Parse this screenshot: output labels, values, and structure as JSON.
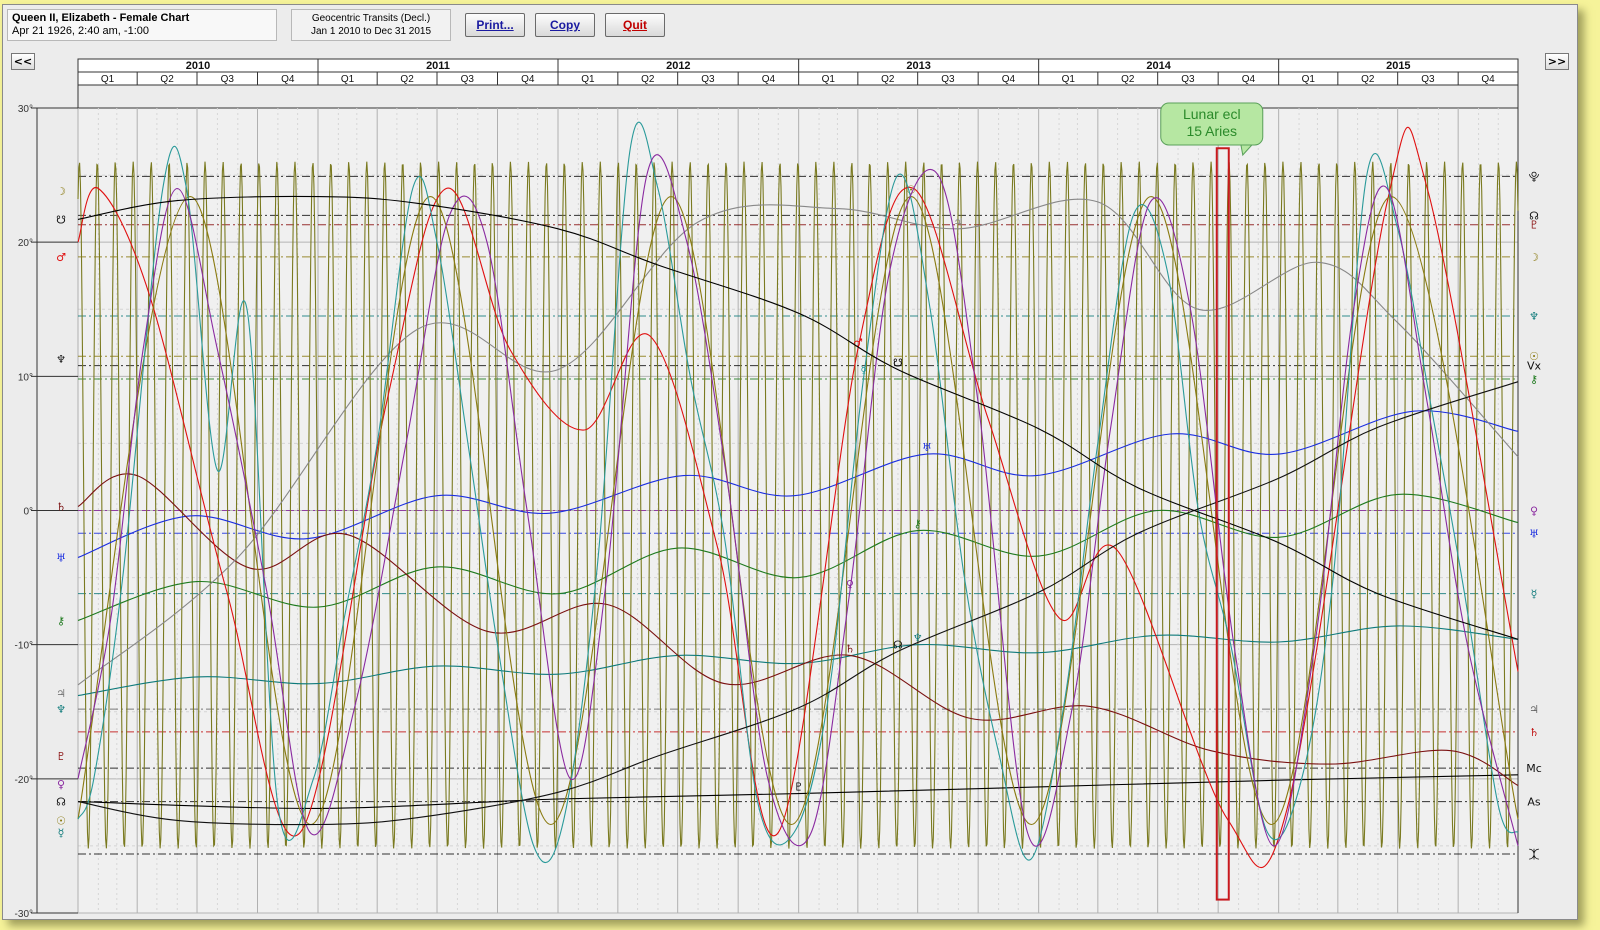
{
  "header": {
    "chart_name": "Queen II, Elizabeth - Female Chart",
    "birth_data": "Apr 21 1926, 2:40 am, -1:00",
    "chart_type": "Geocentric Transits (Decl.)",
    "date_range": "Jan 1 2010 to Dec 31 2015"
  },
  "buttons": {
    "print": "Print...",
    "copy": "Copy",
    "quit": "Quit"
  },
  "nav": {
    "prev": "<<",
    "next": ">>"
  },
  "colors": {
    "frame_bg": "#ececec",
    "plot_bg": "#f0f0f0",
    "outer_bg": "#f6f39a",
    "print_text": "#1a1aa0",
    "copy_text": "#1a1aa0",
    "quit_text": "#c00000",
    "event_box": "#c8191e",
    "tooltip_bg": "#b6e7a2"
  },
  "chart_data": {
    "type": "line",
    "x": {
      "start": "2010-01-01",
      "end": "2015-12-31",
      "years": [
        "2010",
        "2011",
        "2012",
        "2013",
        "2014",
        "2015"
      ],
      "quarters": [
        "Q1",
        "Q2",
        "Q3",
        "Q4"
      ]
    },
    "ylim": [
      -30,
      30
    ],
    "yticks": [
      30,
      20,
      10,
      0,
      -10,
      -20,
      -30
    ],
    "ytick_labels": [
      "30°",
      "20°",
      "10°",
      "0°",
      "-10°",
      "-20°",
      "-30°"
    ],
    "grid": true,
    "event": {
      "label_line1": "Lunar ecl",
      "label_line2": "15 Aries",
      "date": "2014-10-08"
    },
    "moon": {
      "color": "#7a7a20",
      "amplitude": 25.6,
      "period_days": 27.32,
      "mean": 0.4
    },
    "series": [
      {
        "glyph": "♇",
        "color": "#000000",
        "x": [
          "2010-01-01",
          "2011-01-01",
          "2012-01-01",
          "2013-01-01",
          "2014-01-01",
          "2015-01-01",
          "2015-12-31"
        ],
        "y": [
          -21.7,
          -22.2,
          -21.5,
          -21.1,
          -20.6,
          -20.1,
          -19.7
        ]
      },
      {
        "glyph": "♆",
        "color": "#0e7a7a",
        "x": [
          "2010-01-01",
          "2010-07-01",
          "2011-01-01",
          "2011-07-01",
          "2012-01-01",
          "2012-07-01",
          "2013-01-01",
          "2013-07-01",
          "2014-01-01",
          "2014-07-01",
          "2015-01-01",
          "2015-07-01",
          "2015-12-31"
        ],
        "y": [
          -13.8,
          -12.4,
          -12.9,
          -11.6,
          -12.2,
          -10.8,
          -11.4,
          -10.0,
          -10.6,
          -9.3,
          -9.8,
          -8.6,
          -9.6
        ]
      },
      {
        "glyph": "♅",
        "color": "#1a2ee0",
        "x": [
          "2010-01-01",
          "2010-06-20",
          "2010-12-15",
          "2011-07-01",
          "2011-12-20",
          "2012-07-10",
          "2012-12-25",
          "2013-07-15",
          "2013-12-28",
          "2014-07-20",
          "2015-01-01",
          "2015-07-25",
          "2015-12-31"
        ],
        "y": [
          -3.5,
          -0.4,
          -2.1,
          1.1,
          -0.2,
          2.6,
          1.1,
          4.2,
          2.6,
          5.7,
          4.2,
          7.4,
          5.9
        ]
      },
      {
        "glyph": "⚷",
        "color": "#1e7a1e",
        "x": [
          "2010-01-01",
          "2010-07-01",
          "2011-01-01",
          "2011-07-01",
          "2012-01-01",
          "2012-07-01",
          "2013-01-01",
          "2013-07-01",
          "2014-01-01",
          "2014-07-01",
          "2015-01-01",
          "2015-07-01",
          "2015-12-31"
        ],
        "y": [
          -8.2,
          -5.3,
          -7.2,
          -4.2,
          -6.2,
          -2.8,
          -5.0,
          -1.5,
          -3.4,
          0.0,
          -2.0,
          1.2,
          -0.9
        ]
      },
      {
        "glyph": "♄",
        "color": "#7a1010",
        "x": [
          "2010-01-01",
          "2010-04-01",
          "2010-09-20",
          "2011-02-15",
          "2011-09-15",
          "2012-03-15",
          "2012-09-10",
          "2013-03-20",
          "2013-09-20",
          "2014-03-20",
          "2014-09-20",
          "2015-03-20",
          "2015-09-20",
          "2015-12-31"
        ],
        "y": [
          0.3,
          2.6,
          -4.3,
          -1.8,
          -9.0,
          -7.0,
          -12.9,
          -10.8,
          -15.5,
          -14.6,
          -17.9,
          -18.9,
          -17.9,
          -20.5
        ]
      },
      {
        "glyph": "♃",
        "color": "#888888",
        "x": [
          "2010-01-01",
          "2010-09-01",
          "2011-06-01",
          "2012-01-01",
          "2012-08-01",
          "2013-03-01",
          "2013-09-01",
          "2014-04-01",
          "2014-09-01",
          "2015-03-01",
          "2015-07-01",
          "2015-12-31"
        ],
        "y": [
          -13.0,
          -3.5,
          13.5,
          10.5,
          21.5,
          22.5,
          21.0,
          23.0,
          15.0,
          18.5,
          14.0,
          4.0
        ]
      },
      {
        "glyph": "♂",
        "color": "#e01010",
        "x": [
          "2010-01-01",
          "2010-02-01",
          "2010-04-20",
          "2010-08-15",
          "2010-12-05",
          "2011-04-15",
          "2011-07-15",
          "2011-10-20",
          "2012-02-10",
          "2012-05-20",
          "2012-09-01",
          "2012-12-01",
          "2013-04-01",
          "2013-06-25",
          "2013-10-15",
          "2014-02-01",
          "2014-05-01",
          "2014-10-15",
          "2015-01-15",
          "2015-06-15",
          "2015-08-15",
          "2015-12-31"
        ],
        "y": [
          20,
          24,
          16,
          -6,
          -24,
          8,
          24,
          12,
          6,
          13,
          -3,
          -24,
          12,
          24,
          7,
          -8,
          -3,
          -23,
          -22,
          23,
          24,
          -12
        ]
      },
      {
        "glyph": "☉",
        "color": "#8a7a10",
        "x": [
          "2010-01-01",
          "2010-06-21",
          "2010-12-21",
          "2011-06-21",
          "2011-12-21",
          "2012-06-21",
          "2012-12-21",
          "2013-06-21",
          "2013-12-21",
          "2014-06-21",
          "2014-12-21",
          "2015-06-21",
          "2015-12-31"
        ],
        "y": [
          -23,
          23.4,
          -23.4,
          23.4,
          -23.4,
          23.4,
          -23.4,
          23.4,
          -23.4,
          23.4,
          -23.4,
          23.4,
          -23
        ]
      },
      {
        "glyph": "☿",
        "color": "#2a9a9a",
        "x": [
          "2010-01-01",
          "2010-01-25",
          "2010-03-10",
          "2010-05-10",
          "2010-06-15",
          "2010-08-01",
          "2010-09-15",
          "2010-11-01",
          "2010-12-25",
          "2011-02-10",
          "2011-04-01",
          "2011-05-25",
          "2011-07-01",
          "2011-08-20",
          "2011-10-01",
          "2011-11-25",
          "2012-01-10",
          "2012-03-01",
          "2012-04-20",
          "2012-06-01",
          "2012-07-20",
          "2012-09-10",
          "2012-11-01",
          "2012-12-25",
          "2013-02-15",
          "2013-04-10",
          "2013-06-01",
          "2013-07-20",
          "2013-09-10",
          "2013-11-01",
          "2013-12-20",
          "2014-02-10",
          "2014-04-01",
          "2014-05-25",
          "2014-07-15",
          "2014-09-01",
          "2014-10-20",
          "2014-12-15",
          "2015-02-05",
          "2015-03-25",
          "2015-05-15",
          "2015-07-01",
          "2015-08-20",
          "2015-10-10",
          "2015-12-01",
          "2015-12-31"
        ],
        "y": [
          -23,
          -20,
          -5,
          24,
          24,
          3,
          15,
          -22,
          -20,
          -8,
          5,
          24,
          20,
          4,
          -10,
          -25,
          -23,
          -4,
          27,
          24,
          10,
          -2,
          -22,
          -24,
          -14,
          10,
          25,
          15,
          -5,
          -18,
          -26,
          -14,
          5,
          22,
          18,
          0,
          -10,
          -24,
          -20,
          -5,
          25,
          21,
          8,
          -6,
          -22,
          -24
        ]
      },
      {
        "glyph": "♀",
        "color": "#8a2aa0",
        "x": [
          "2010-01-01",
          "2010-02-20",
          "2010-04-10",
          "2010-06-01",
          "2010-08-01",
          "2010-10-15",
          "2010-12-20",
          "2011-03-01",
          "2011-05-15",
          "2011-07-20",
          "2011-09-15",
          "2011-11-15",
          "2012-01-20",
          "2012-03-15",
          "2012-05-15",
          "2012-07-15",
          "2012-09-15",
          "2012-11-15",
          "2013-01-20",
          "2013-03-20",
          "2013-05-20",
          "2013-08-01",
          "2013-10-01",
          "2013-12-15",
          "2014-02-20",
          "2014-04-20",
          "2014-06-20",
          "2014-08-20",
          "2014-10-25",
          "2014-12-25",
          "2015-02-25",
          "2015-04-25",
          "2015-06-15",
          "2015-08-15",
          "2015-10-15",
          "2015-12-31"
        ],
        "y": [
          -20,
          -8,
          12,
          24,
          12,
          -6,
          -24,
          -14,
          5,
          22,
          20,
          0,
          -20,
          -5,
          25,
          20,
          2,
          -20,
          -24,
          -6,
          18,
          25,
          8,
          -24,
          -15,
          6,
          23,
          15,
          -10,
          -25,
          -10,
          15,
          24,
          8,
          -10,
          -25
        ]
      },
      {
        "glyph": "☊",
        "color": "#111111",
        "x": [
          "2010-01-01",
          "2010-06-01",
          "2011-01-01",
          "2011-06-01",
          "2012-01-01",
          "2012-06-01",
          "2013-01-01",
          "2013-06-01",
          "2014-01-01",
          "2014-06-01",
          "2015-01-01",
          "2015-06-01",
          "2015-12-31"
        ],
        "y": [
          -21.7,
          -23.1,
          -23.4,
          -22.9,
          -21.0,
          -18.3,
          -14.7,
          -10.5,
          -6.1,
          -1.7,
          2.4,
          6.2,
          9.6
        ]
      },
      {
        "glyph": "☋",
        "color": "#000000",
        "x": [
          "2010-01-01",
          "2010-06-01",
          "2011-01-01",
          "2011-06-01",
          "2012-01-01",
          "2012-06-01",
          "2013-01-01",
          "2013-06-01",
          "2014-01-01",
          "2014-06-01",
          "2015-01-01",
          "2015-06-01",
          "2015-12-31"
        ],
        "y": [
          21.7,
          23.1,
          23.4,
          22.9,
          21.0,
          18.3,
          14.7,
          10.5,
          6.1,
          1.7,
          -2.4,
          -6.2,
          -9.6
        ]
      }
    ],
    "natal_lines": [
      {
        "glyph": "⯓",
        "value": 24.9,
        "color": "#111111"
      },
      {
        "glyph": "☊",
        "value": 22.0,
        "color": "#111111"
      },
      {
        "glyph": "♇",
        "value": 21.3,
        "color": "#8a1010"
      },
      {
        "glyph": "☽",
        "value": 18.9,
        "color": "#8a7a10"
      },
      {
        "glyph": "♆",
        "value": 14.5,
        "color": "#0e7a7a"
      },
      {
        "glyph": "☉",
        "value": 11.5,
        "color": "#8a7a10"
      },
      {
        "glyph": "Vx",
        "value": 10.8,
        "color": "#111111"
      },
      {
        "glyph": "⚷",
        "value": 9.8,
        "color": "#1e7a1e"
      },
      {
        "glyph": "♀",
        "value": 0.0,
        "color": "#8a2aa0"
      },
      {
        "glyph": "♅",
        "value": -1.7,
        "color": "#1a2ee0"
      },
      {
        "glyph": "☿",
        "value": -6.2,
        "color": "#0e7a7a"
      },
      {
        "glyph": "♃",
        "value": -14.8,
        "color": "#666666"
      },
      {
        "glyph": "♄",
        "value": -16.5,
        "color": "#c01010"
      },
      {
        "glyph": "Mc",
        "value": -19.2,
        "color": "#111111"
      },
      {
        "glyph": "As",
        "value": -21.7,
        "color": "#111111"
      },
      {
        "glyph": "⯰",
        "value": -25.6,
        "color": "#111111"
      }
    ],
    "left_glyphs": [
      {
        "glyph": "☽",
        "value": 23.8,
        "color": "#8a7a10"
      },
      {
        "glyph": "☋",
        "value": 21.7,
        "color": "#111111"
      },
      {
        "glyph": "♂",
        "value": 18.9,
        "color": "#e01010"
      },
      {
        "glyph": "♆",
        "value": 11.3,
        "color": "#111111"
      },
      {
        "glyph": "♄",
        "value": 0.3,
        "color": "#7a1010"
      },
      {
        "glyph": "♅",
        "value": -3.5,
        "color": "#1a2ee0"
      },
      {
        "glyph": "⚷",
        "value": -8.2,
        "color": "#1e7a1e"
      },
      {
        "glyph": "♃",
        "value": -13.6,
        "color": "#777777"
      },
      {
        "glyph": "♆",
        "value": -14.8,
        "color": "#0e7a7a"
      },
      {
        "glyph": "♇",
        "value": -18.3,
        "color": "#8a1010"
      },
      {
        "glyph": "♀",
        "value": -20.4,
        "color": "#8a2aa0"
      },
      {
        "glyph": "☊",
        "value": -21.7,
        "color": "#111111"
      },
      {
        "glyph": "☉",
        "value": -23.1,
        "color": "#8a7a10"
      },
      {
        "glyph": "☿",
        "value": -24.0,
        "color": "#0e7a7a"
      }
    ]
  }
}
